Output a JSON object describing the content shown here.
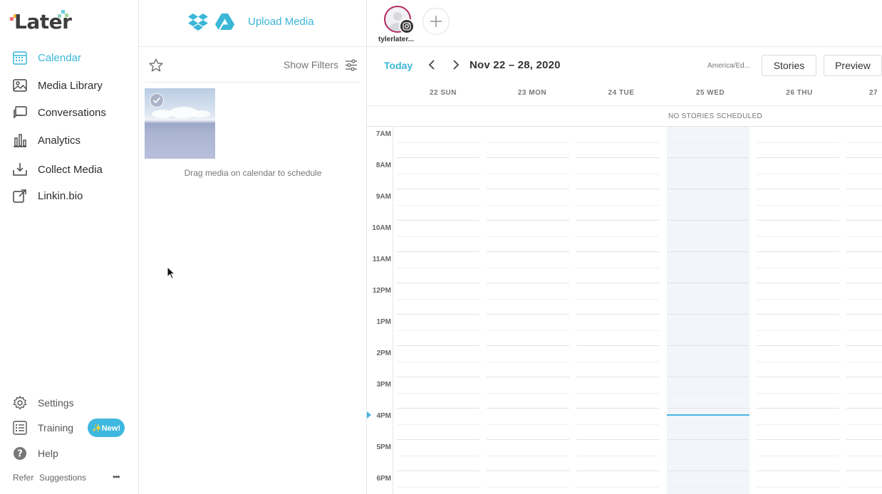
{
  "app": {
    "logo_text": "Later",
    "accent_color": "#3ab6d8"
  },
  "sidebar": {
    "nav": [
      {
        "label": "Calendar",
        "icon": "calendar-icon",
        "active": true
      },
      {
        "label": "Media Library",
        "icon": "image-icon"
      },
      {
        "label": "Conversations",
        "icon": "chat-icon"
      },
      {
        "label": "Analytics",
        "icon": "bar-chart-icon"
      },
      {
        "label": "Collect Media",
        "icon": "download-tray-icon"
      },
      {
        "label": "Linkin.bio",
        "icon": "link-edit-icon"
      }
    ],
    "bottom_nav": [
      {
        "label": "Settings",
        "icon": "gear-icon"
      },
      {
        "label": "Training",
        "icon": "checklist-icon"
      },
      {
        "label": "Help",
        "icon": "help-icon"
      }
    ],
    "new_badge": "✨New!",
    "footer": {
      "refer": "Refer",
      "suggestions": "Suggestions",
      "more": "•••"
    }
  },
  "media": {
    "upload_label": "Upload Media",
    "show_filters": "Show Filters",
    "drag_hint": "Drag media on calendar to schedule"
  },
  "calendar": {
    "account_name": "tylerlater...",
    "today_label": "Today",
    "date_range": "Nov 22 – 28, 2020",
    "timezone": "America/Ed...",
    "stories_button": "Stories",
    "preview_button": "Preview",
    "days": [
      "22 SUN",
      "23 MON",
      "24 TUE",
      "25 WED",
      "26 THU",
      "27"
    ],
    "no_stories": "NO STORIES SCHEDULED",
    "hours": [
      "7AM",
      "8AM",
      "9AM",
      "10AM",
      "11AM",
      "12PM",
      "1PM",
      "2PM",
      "3PM",
      "4PM",
      "5PM",
      "6PM"
    ]
  }
}
